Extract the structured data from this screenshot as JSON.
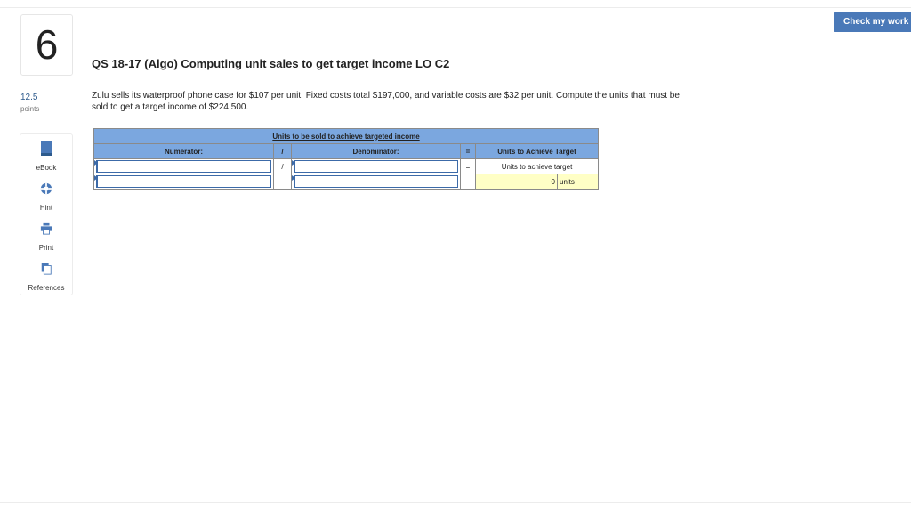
{
  "header": {
    "check_button": "Check my work"
  },
  "question": {
    "number": "6",
    "points_value": "12.5",
    "points_label": "points",
    "title": "QS 18-17 (Algo) Computing unit sales to get target income LO C2",
    "prompt": "Zulu sells its waterproof phone case for $107 per unit. Fixed costs total $197,000, and variable costs are $32 per unit. Compute the units that must be sold to get a target income of $224,500."
  },
  "tools": [
    {
      "label": "eBook",
      "icon": "book-icon"
    },
    {
      "label": "Hint",
      "icon": "lifebuoy-icon"
    },
    {
      "label": "Print",
      "icon": "printer-icon"
    },
    {
      "label": "References",
      "icon": "copy-icon"
    }
  ],
  "worksheet": {
    "title": "Units to be sold to achieve targeted income",
    "headers": {
      "numerator": "Numerator:",
      "divide": "/",
      "denominator": "Denominator:",
      "equals": "=",
      "result": "Units to Achieve Target"
    },
    "rows": [
      {
        "numerator": "",
        "divide": "/",
        "denominator": "",
        "equals": "=",
        "result_label": "Units to achieve target"
      },
      {
        "numerator": "",
        "divide": "",
        "denominator": "",
        "equals": "",
        "result_value": "0",
        "result_unit": "units"
      }
    ]
  },
  "colors": {
    "accent": "#4a79b8",
    "header_bg": "#7ba7df",
    "result_bg": "#ffffc6"
  }
}
